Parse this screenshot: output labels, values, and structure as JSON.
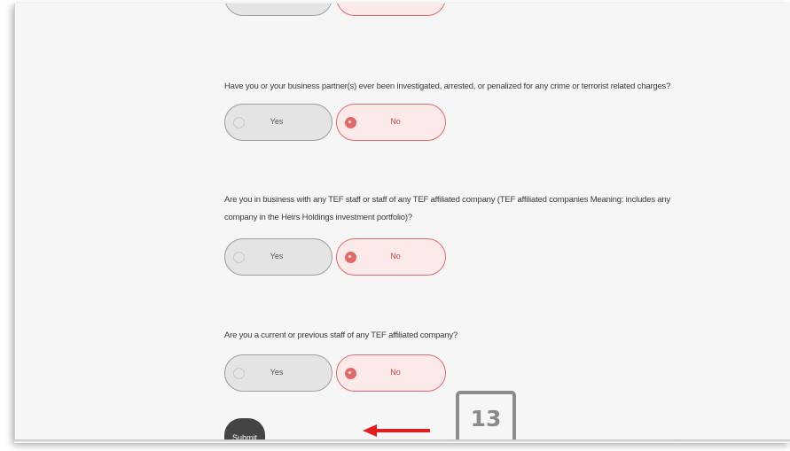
{
  "questions": [
    {
      "text": "",
      "yes_label": "",
      "no_label": "",
      "selected": "no"
    },
    {
      "text": "Have you or your business partner(s) ever been investigated, arrested, or penalized for any crime or terrorist related charges?",
      "yes_label": "Yes",
      "no_label": "No",
      "selected": "no"
    },
    {
      "text": "Are you in business with any TEF staff or staff of any TEF affiliated company (TEF affiliated companies Meaning: includes any company in the Heirs Holdings investment portfolio)?",
      "yes_label": "Yes",
      "no_label": "No",
      "selected": "no"
    },
    {
      "text": "Are you a current or previous staff of any TEF affiliated company?",
      "yes_label": "Yes",
      "no_label": "No",
      "selected": "no"
    }
  ],
  "submit_label": "Submit",
  "annotation": {
    "step_number": "13",
    "arrow_color": "#e01e1e",
    "badge_color": "#8c8c8c"
  },
  "colors": {
    "selected_border": "#e06a6a",
    "selected_fill": "#fce9e9",
    "unselected_fill": "#e4e4e4",
    "submit_fill": "#444444"
  }
}
